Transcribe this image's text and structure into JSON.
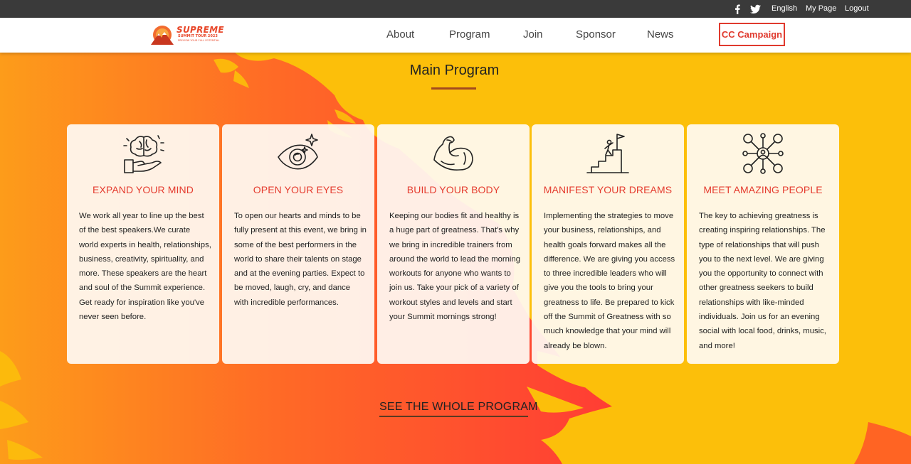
{
  "topbar": {
    "icons": [
      "facebook-icon",
      "twitter-icon"
    ],
    "links": [
      "English",
      "My Page",
      "Logout"
    ]
  },
  "header": {
    "logo": {
      "line1": "SUPREME",
      "line2": "SUMMIT TOUR 2023",
      "line3": "PREVIEW YOUR FULL POTENTIAL"
    },
    "nav": [
      "About",
      "Program",
      "Join",
      "Sponsor",
      "News"
    ],
    "cta": "CC Campaign"
  },
  "main": {
    "title": "Main Program",
    "cards": [
      {
        "icon": "brain-hand-icon",
        "title": "EXPAND YOUR MIND",
        "text": "We work all year to line up the best of the best speakers.We curate world experts in health, relationships, business, creativity, spirituality, and more. These speakers are the heart and soul of the Summit experience. Get ready for inspiration like you've never seen before."
      },
      {
        "icon": "eye-sparkle-icon",
        "title": "OPEN YOUR EYES",
        "text": "To open our hearts and minds to be fully present at this event, we bring in some of the best performers in the world to share their talents on stage and at the evening parties. Expect to be moved, laugh, cry, and dance with incredible performances."
      },
      {
        "icon": "flexed-arm-icon",
        "title": "BUILD YOUR BODY",
        "text": "Keeping our bodies fit and healthy is a huge part of greatness. That's why we bring in incredible trainers from around the world to lead the morning workouts for anyone who wants to join us. Take your pick of a variety of workout styles and levels and start your Summit mornings strong!"
      },
      {
        "icon": "stairs-flag-icon",
        "title": "MANIFEST YOUR DREAMS",
        "text": "Implementing the strategies to move your business, relationships, and health goals forward makes all the difference. We are giving you access to three incredible leaders who will give you the tools to bring your greatness to life. Be prepared to kick off the Summit of Greatness with so much knowledge that your mind will already be blown."
      },
      {
        "icon": "people-network-icon",
        "title": "MEET AMAZING PEOPLE",
        "text": "The key to achieving greatness is creating inspiring relationships. The type of relationships that will push you to the next level. We are giving you the opportunity to connect with other greatness seekers to build relationships with like-minded individuals. Join us for an evening social with local food, drinks, music, and more!"
      }
    ],
    "see_all": "SEE THE WHOLE PROGRAM"
  },
  "colors": {
    "topbar": "#3a3a3a",
    "accent_red": "#e53c2f",
    "background_yellow": "#fcbf0a",
    "background_orange": "#ff4a2b",
    "card_bg": "#fffaf3"
  }
}
